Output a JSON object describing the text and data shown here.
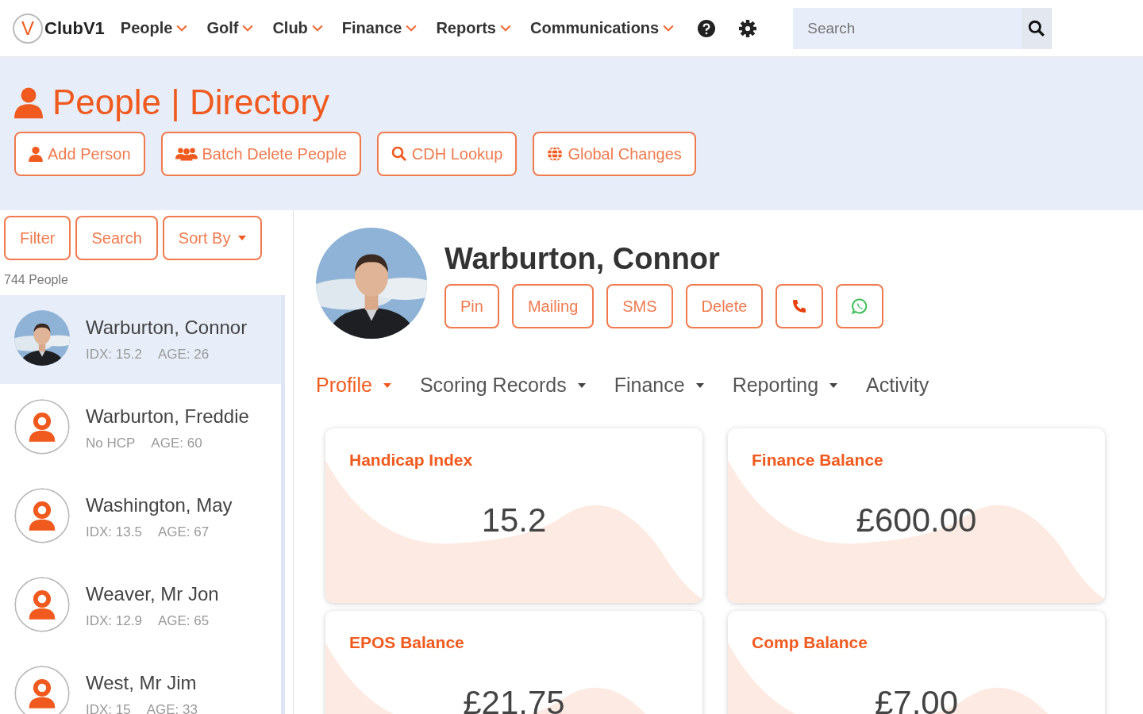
{
  "brand": {
    "logo": "V",
    "name": "ClubV1"
  },
  "nav": [
    {
      "label": "People"
    },
    {
      "label": "Golf"
    },
    {
      "label": "Club"
    },
    {
      "label": "Finance"
    },
    {
      "label": "Reports"
    },
    {
      "label": "Communications"
    }
  ],
  "search": {
    "placeholder": "Search"
  },
  "page": {
    "title": "People | Directory",
    "actions": [
      {
        "label": "Add Person",
        "kind": "person"
      },
      {
        "label": "Batch Delete People",
        "kind": "people"
      },
      {
        "label": "CDH Lookup",
        "kind": "search"
      },
      {
        "label": "Global Changes",
        "kind": "globe"
      }
    ]
  },
  "sidebar": {
    "buttons": [
      {
        "label": "Filter",
        "dropdown": false
      },
      {
        "label": "Search",
        "dropdown": false
      },
      {
        "label": "Sort By",
        "dropdown": true
      }
    ],
    "count": "744 People",
    "items": [
      {
        "name": "Warburton, Connor",
        "handicap": "IDX: 15.2",
        "age": "AGE: 26",
        "selected": true
      },
      {
        "name": "Warburton, Freddie",
        "handicap": "No HCP",
        "age": "AGE: 60",
        "kind": "placeholder",
        "selected": false
      },
      {
        "name": "Washington, May",
        "handicap": "IDX: 13.5",
        "age": "AGE: 67",
        "kind": "placeholder",
        "selected": false
      },
      {
        "name": "Weaver, Mr Jon",
        "handicap": "IDX: 12.9",
        "age": "AGE: 65",
        "kind": "placeholder",
        "selected": false
      },
      {
        "name": "West, Mr Jim",
        "handicap": "IDX: 15",
        "age": "AGE: 33",
        "kind": "placeholder",
        "selected": false
      }
    ]
  },
  "profile": {
    "name": "Warburton, Connor",
    "buttons": [
      {
        "kind": "text",
        "label": "Pin"
      },
      {
        "kind": "text",
        "label": "Mailing"
      },
      {
        "kind": "text",
        "label": "SMS"
      },
      {
        "kind": "text",
        "label": "Delete"
      },
      {
        "kind": "phone"
      },
      {
        "kind": "whatsapp"
      }
    ],
    "tabs": [
      {
        "label": "Profile",
        "dropdown": true,
        "selected": true
      },
      {
        "label": "Scoring Records",
        "dropdown": true,
        "selected": false
      },
      {
        "label": "Finance",
        "dropdown": true,
        "selected": false
      },
      {
        "label": "Reporting",
        "dropdown": true,
        "selected": false
      },
      {
        "label": "Activity",
        "dropdown": false,
        "selected": false
      }
    ],
    "cards": [
      {
        "title": "Handicap Index",
        "value": "15.2"
      },
      {
        "title": "Finance Balance",
        "value": "£600.00"
      },
      {
        "title": "EPOS Balance",
        "value": "£21.75"
      },
      {
        "title": "Comp Balance",
        "value": "£7.00"
      }
    ]
  }
}
